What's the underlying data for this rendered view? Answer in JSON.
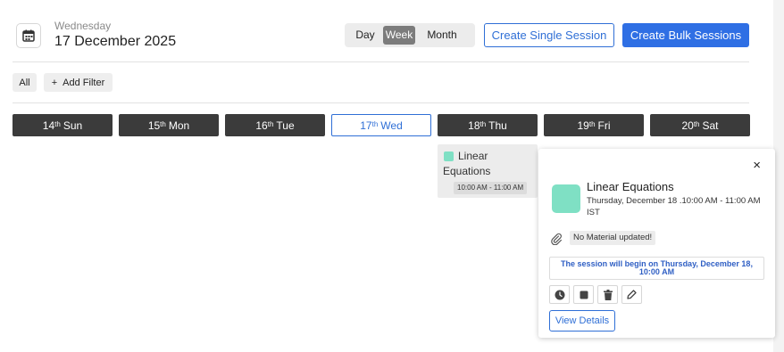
{
  "header": {
    "weekday": "Wednesday",
    "date": "17 December 2025",
    "calendar_icon": "calendar-icon"
  },
  "view_toggle": {
    "day": "Day",
    "week": "Week",
    "month": "Month",
    "selected": "Week"
  },
  "actions": {
    "create_single": "Create Single Session",
    "create_bulk": "Create Bulk Sessions"
  },
  "filters": {
    "all": "All",
    "add_symbol": "+",
    "add_label": "Add Filter"
  },
  "days": [
    {
      "num": "14",
      "suffix": "th",
      "name": "Sun"
    },
    {
      "num": "15",
      "suffix": "th",
      "name": "Mon"
    },
    {
      "num": "16",
      "suffix": "th",
      "name": "Tue"
    },
    {
      "num": "17",
      "suffix": "th",
      "name": "Wed"
    },
    {
      "num": "18",
      "suffix": "th",
      "name": "Thu"
    },
    {
      "num": "19",
      "suffix": "th",
      "name": "Fri"
    },
    {
      "num": "20",
      "suffix": "th",
      "name": "Sat"
    }
  ],
  "event": {
    "title": "Linear Equations",
    "time": "10:00 AM - 11:00 AM",
    "color": "#7fe0c4"
  },
  "popover": {
    "close": "×",
    "title": "Linear Equations",
    "when": "Thursday, December 18 .10:00 AM - 11:00 AM IST",
    "material": "No Material updated!",
    "notice": "The session will begin on Thursday, December 18, 10:00 AM",
    "details_button": "View Details",
    "action_icons": [
      "clock-icon",
      "stop-icon",
      "trash-icon",
      "edit-icon"
    ]
  },
  "colors": {
    "accent": "#2f6fd6",
    "primary_button": "#2f6fe4",
    "day_pill": "#3b3b3b",
    "event_swatch": "#7fe0c4"
  }
}
